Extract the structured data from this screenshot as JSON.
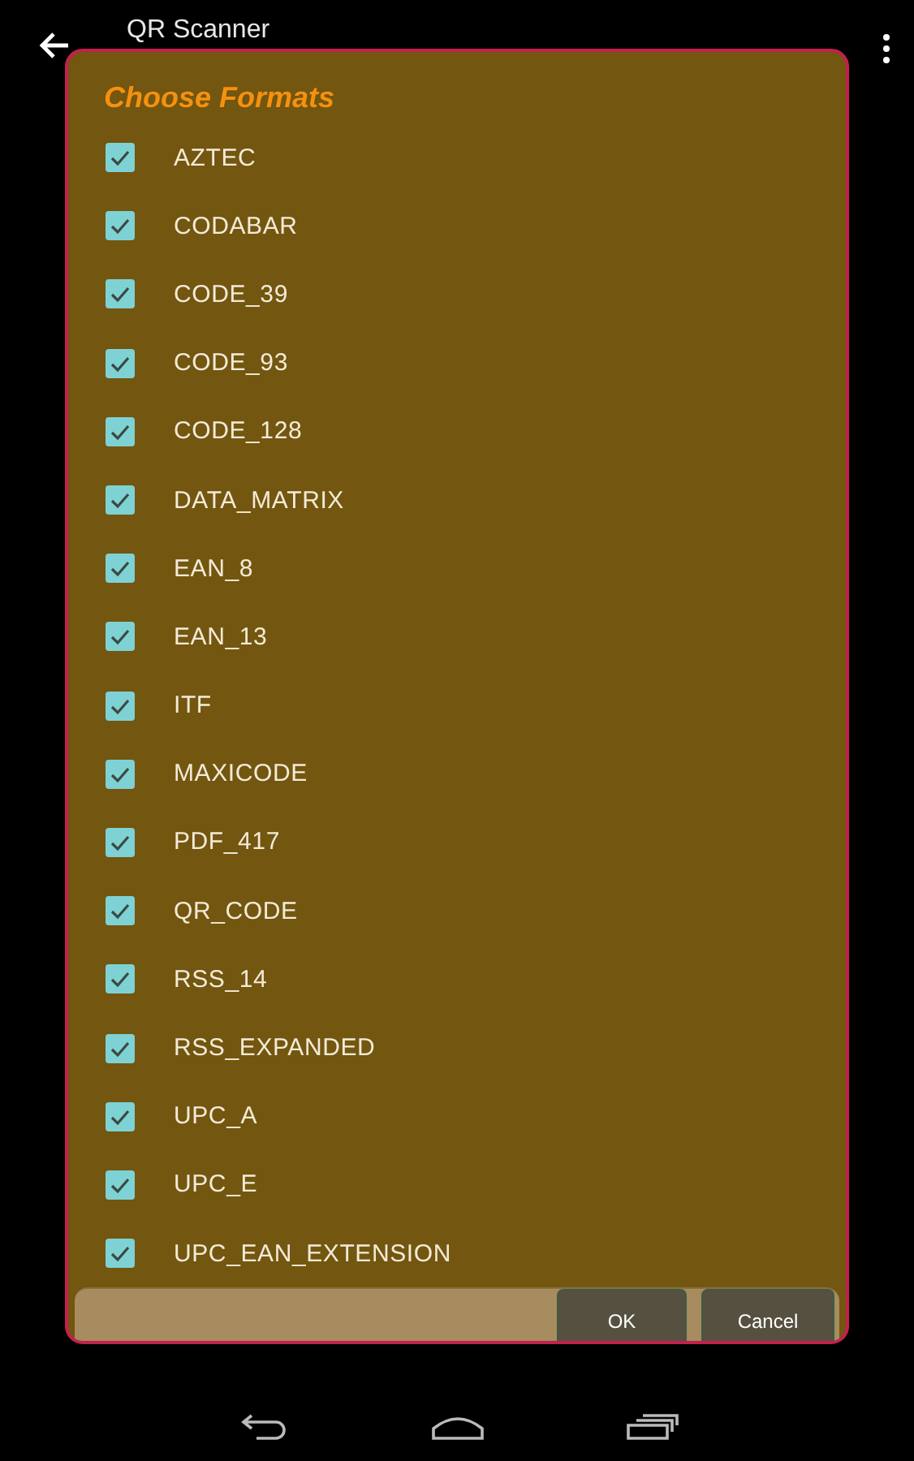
{
  "app_bar": {
    "title": "QR Scanner"
  },
  "dialog": {
    "title": "Choose Formats",
    "items": [
      {
        "label": "AZTEC",
        "checked": true
      },
      {
        "label": "CODABAR",
        "checked": true
      },
      {
        "label": "CODE_39",
        "checked": true
      },
      {
        "label": "CODE_93",
        "checked": true
      },
      {
        "label": "CODE_128",
        "checked": true
      },
      {
        "label": "DATA_MATRIX",
        "checked": true
      },
      {
        "label": "EAN_8",
        "checked": true
      },
      {
        "label": "EAN_13",
        "checked": true
      },
      {
        "label": "ITF",
        "checked": true
      },
      {
        "label": "MAXICODE",
        "checked": true
      },
      {
        "label": "PDF_417",
        "checked": true
      },
      {
        "label": "QR_CODE",
        "checked": true
      },
      {
        "label": "RSS_14",
        "checked": true
      },
      {
        "label": "RSS_EXPANDED",
        "checked": true
      },
      {
        "label": "UPC_A",
        "checked": true
      },
      {
        "label": "UPC_E",
        "checked": true
      },
      {
        "label": "UPC_EAN_EXTENSION",
        "checked": true
      }
    ],
    "buttons": [
      "OK",
      "Cancel"
    ]
  }
}
